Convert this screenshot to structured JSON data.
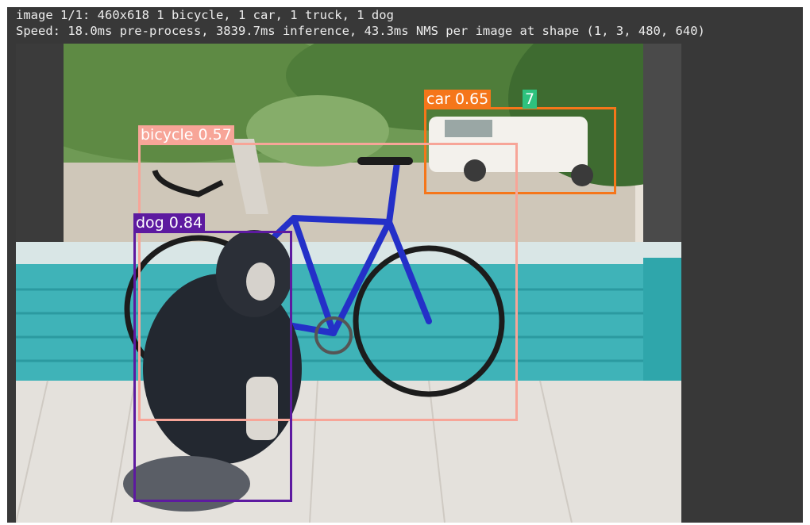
{
  "console": {
    "lines": [
      "image 1/1: 460x618 1 bicycle, 1 car, 1 truck, 1 dog",
      "Speed: 18.0ms pre-process, 3839.7ms inference, 43.3ms NMS per image at shape (1, 3, 480, 640)"
    ]
  },
  "detections": [
    {
      "class": "car",
      "score": "0.65",
      "label": "car 0.65",
      "color": "#f5761a",
      "text_color": "#ffffff"
    },
    {
      "class": "bicycle",
      "score": "0.57",
      "label": "bicycle 0.57",
      "color": "#f7a598",
      "text_color": "#ffffff"
    },
    {
      "class": "dog",
      "score": "0.84",
      "label": "dog 0.84",
      "color": "#5d1aa0",
      "text_color": "#ffffff"
    }
  ],
  "occluded_label": {
    "text": "7",
    "color": "#2ec27e",
    "text_color": "#ffffff"
  },
  "colors": {
    "panel_bg": "#383838",
    "console_text": "#ececec"
  }
}
